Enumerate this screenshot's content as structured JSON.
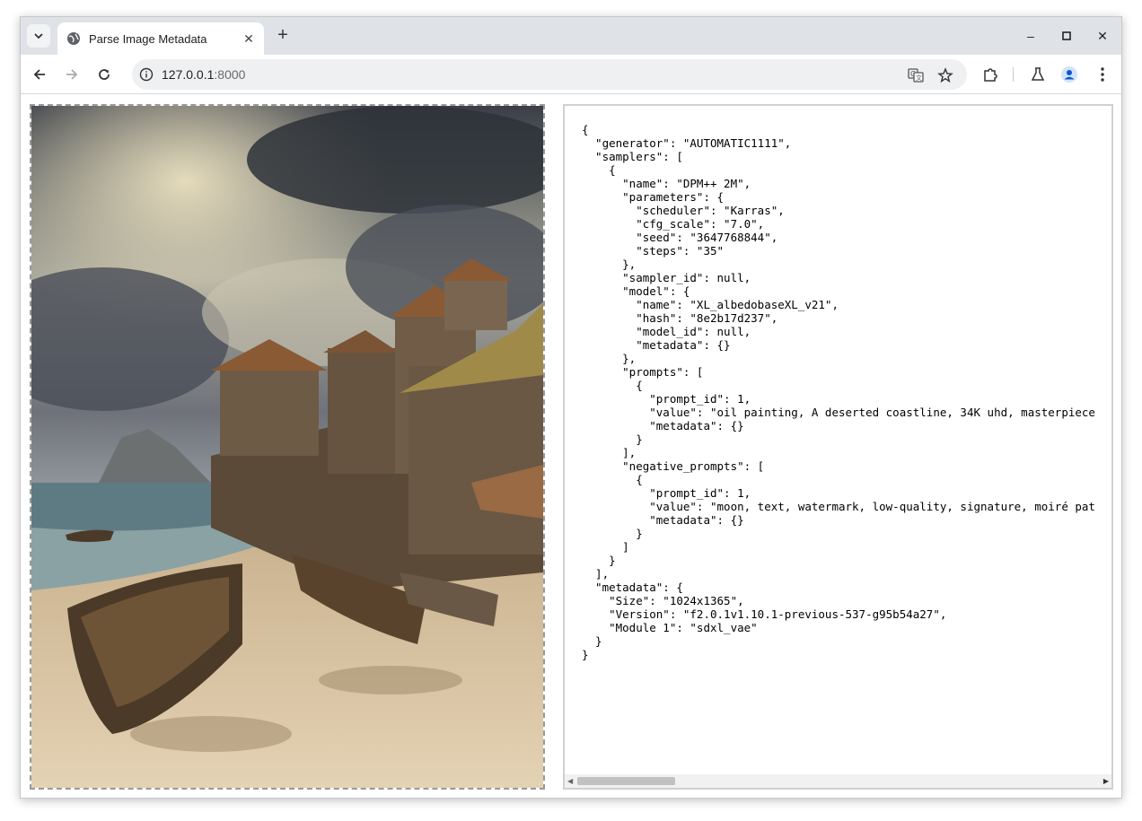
{
  "browser": {
    "tab": {
      "title": "Parse Image Metadata",
      "favicon": "globe-icon"
    },
    "new_tab_label": "+",
    "address": {
      "host": "127.0.0.1",
      "port": ":8000"
    },
    "controls": {
      "minimize": "–",
      "maximize": "□",
      "close": "✕"
    }
  },
  "page": {
    "image": {
      "alt": "oil painting, A deserted coastline"
    },
    "json_text": "{\n  \"generator\": \"AUTOMATIC1111\",\n  \"samplers\": [\n    {\n      \"name\": \"DPM++ 2M\",\n      \"parameters\": {\n        \"scheduler\": \"Karras\",\n        \"cfg_scale\": \"7.0\",\n        \"seed\": \"3647768844\",\n        \"steps\": \"35\"\n      },\n      \"sampler_id\": null,\n      \"model\": {\n        \"name\": \"XL_albedobaseXL_v21\",\n        \"hash\": \"8e2b17d237\",\n        \"model_id\": null,\n        \"metadata\": {}\n      },\n      \"prompts\": [\n        {\n          \"prompt_id\": 1,\n          \"value\": \"oil painting, A deserted coastline, 34K uhd, masterpiece\n          \"metadata\": {}\n        }\n      ],\n      \"negative_prompts\": [\n        {\n          \"prompt_id\": 1,\n          \"value\": \"moon, text, watermark, low-quality, signature, moiré pat\n          \"metadata\": {}\n        }\n      ]\n    }\n  ],\n  \"metadata\": {\n    \"Size\": \"1024x1365\",\n    \"Version\": \"f2.0.1v1.10.1-previous-537-g95b54a27\",\n    \"Module 1\": \"sdxl_vae\"\n  }\n}"
  }
}
